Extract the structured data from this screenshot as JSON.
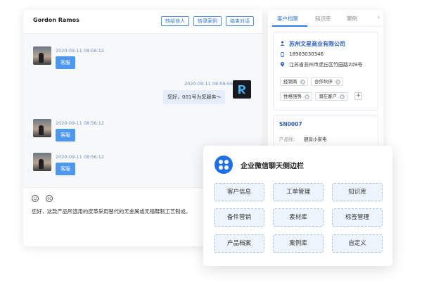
{
  "chat": {
    "contact_name": "Gordon Ramos",
    "buttons": {
      "transfer": "转给他人",
      "record_case": "转录案例",
      "end_chat": "结束对话"
    },
    "messages": [
      {
        "time": "2020-09-11 08:56:12",
        "text": "客服"
      },
      {
        "time": "2020-09-11 08:59:56",
        "text": "您好，001号为您服务～"
      },
      {
        "time": "2020-09-11 08:56:12",
        "text": "客服"
      },
      {
        "time": "2020-09-11 08:56:12",
        "text": "客服"
      }
    ],
    "input_text": "您好，这款产品所选用的皮革采用替代的无金属或无铬鞣制工艺制成。"
  },
  "panel": {
    "tabs": [
      "客户档案",
      "知识库",
      "案例"
    ],
    "active_tab": "客户档案",
    "company": "苏州文星商业有限公司",
    "phone": "18903030346",
    "address": "江苏省苏州市虎丘区竹园路209号",
    "tags": [
      "经销商",
      "合作伙伴",
      "性格强势",
      "潜在客户"
    ],
    "order_no": "SN0007",
    "product_label": "产品线：",
    "product_value": "厨房小家电"
  },
  "popup": {
    "title": "企业微信聊天侧边栏",
    "items": [
      "客户信息",
      "工单管理",
      "知识库",
      "备件营销",
      "素材库",
      "标签管理",
      "产品档案",
      "案例库",
      "自定义"
    ]
  },
  "colors": {
    "accent": "#2f7ae8",
    "bubble": "#4d97ee",
    "popup_button_bg": "#eef4fd"
  }
}
